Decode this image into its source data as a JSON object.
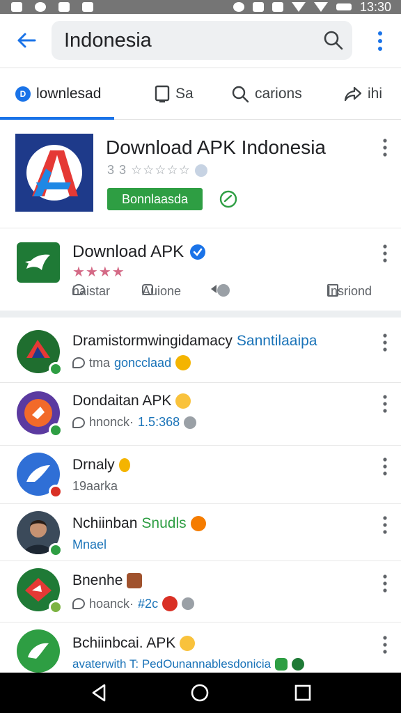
{
  "status_bar": {
    "time": "13:30"
  },
  "search": {
    "query": "Indonesia"
  },
  "tabs": [
    {
      "label": "lownlesad",
      "icon": "download-icon"
    },
    {
      "label": "Sa",
      "icon": "tablet-icon"
    },
    {
      "label": "carions",
      "icon": "search-icon"
    },
    {
      "label": "ihi",
      "icon": "share-icon"
    }
  ],
  "featured": {
    "title": "Download APK Indonesia",
    "rating": "3 3 ☆☆☆☆☆",
    "button": "Bonnlaasda",
    "colors": {
      "logo_bg": "#1e3a8a",
      "button": "#2e9e43"
    }
  },
  "second": {
    "title": "Download APK",
    "stars": "★★★★",
    "meta": [
      "haistar",
      "Auione",
      "Insriond"
    ]
  },
  "list": [
    {
      "title": "Dramistormwingidamacy",
      "title_accent": "Sanntilaaipa",
      "sub": "tma",
      "sub_accent": "goncclaad",
      "avatar_color": "#1f6e2f",
      "badge_color": "#2e9e43"
    },
    {
      "title": "Dondaitan APK",
      "title_accent": "",
      "sub": "hnonck·",
      "sub_accent": "1.5:368",
      "avatar_color": "#5b3aa0",
      "badge_color": "#2e9e43"
    },
    {
      "title": "Drnaly",
      "title_accent": "",
      "sub": "19aarka",
      "sub_accent": "",
      "avatar_color": "#2f6fd6",
      "badge_color": "#d93025"
    },
    {
      "title": "Nchiinban",
      "title_accent": "Snudls",
      "sub": "Mnael",
      "sub_accent": "",
      "avatar_color": "#3b4a5a",
      "badge_color": "#2e9e43"
    },
    {
      "title": "Bnenhe",
      "title_accent": "",
      "sub": "hoanck·",
      "sub_accent": "#2c",
      "avatar_color": "#1f7a36",
      "badge_color": "#2e9e43"
    },
    {
      "title": "Bchiinbcai. APK",
      "title_accent": "",
      "sub": "",
      "sub_accent": "avaterwith T: PedOunannablesdonicia",
      "avatar_color": "#2e9e43",
      "badge_color": "#2e9e43"
    }
  ]
}
